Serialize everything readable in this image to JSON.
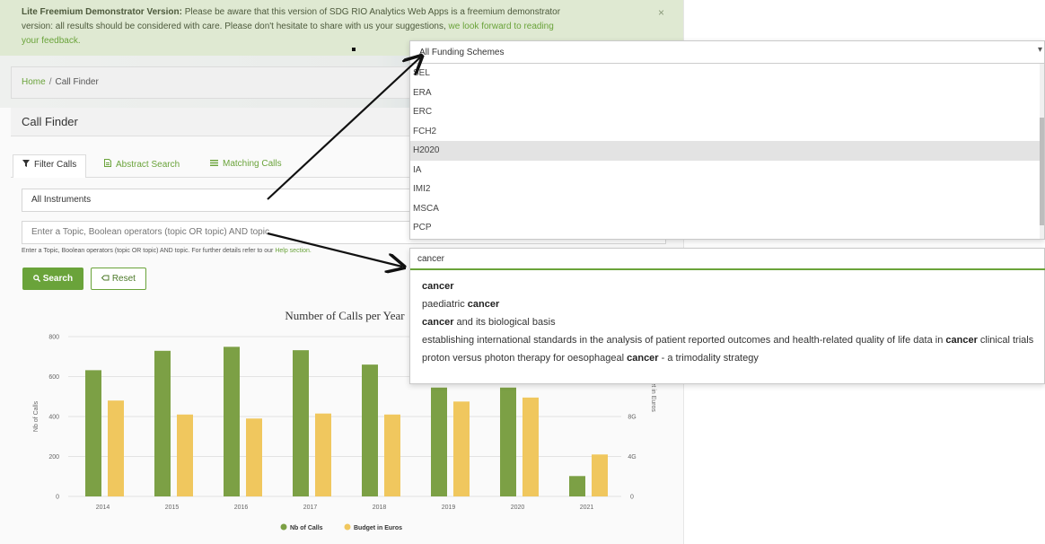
{
  "banner": {
    "bold_text": "Lite Freemium Demonstrator Version:",
    "text_line1": " Please be aware that this version of SDG RIO Analytics Web Apps is a freemium demonstrator",
    "text_line2": "version: all results should be considered with care. Please don't hesitate to share with us your suggestions, ",
    "link_text_part1": "we look forward to reading",
    "link_text_part2": "your feedback.",
    "close_label": "×"
  },
  "breadcrumb": {
    "home": "Home",
    "separator": "/",
    "current": "Call Finder"
  },
  "page_title": "Call Finder",
  "tabs": [
    {
      "label": "Filter Calls",
      "icon": "funnel-icon"
    },
    {
      "label": "Abstract Search",
      "icon": "document-icon"
    },
    {
      "label": "Matching Calls",
      "icon": "list-icon"
    }
  ],
  "filters": {
    "instrument_value": "All Instruments",
    "topic_placeholder": "Enter a Topic, Boolean operators (topic OR topic) AND topic",
    "help_text": "Enter a Topic, Boolean operators (topic OR topic) AND topic. For further details refer to our ",
    "help_link": "Help section."
  },
  "buttons": {
    "search_label": "Search",
    "reset_label": "Reset"
  },
  "funding_dropdown": {
    "selected": "All Funding Schemes",
    "options": [
      "SEL",
      "ERA",
      "ERC",
      "FCH2",
      "H2020",
      "IA",
      "IMI2",
      "MSCA",
      "PCP"
    ],
    "highlighted": "H2020"
  },
  "autocomplete": {
    "input_value": "cancer",
    "suggestions": [
      {
        "before": "",
        "match": "cancer",
        "after": ""
      },
      {
        "before": "paediatric ",
        "match": "cancer",
        "after": ""
      },
      {
        "before": "",
        "match": "cancer",
        "after": " and its biological basis"
      },
      {
        "before": "establishing international standards in the analysis of patient reported outcomes and health-related quality of life data in ",
        "match": "cancer",
        "after": " clinical trials"
      },
      {
        "before": "proton versus photon therapy for oesophageal ",
        "match": "cancer",
        "after": " - a trimodality strategy"
      }
    ]
  },
  "colors": {
    "accent": "#6aa33a",
    "bar_calls": "#7ca045",
    "bar_budget": "#f0c75e",
    "banner_bg": "#dfe9d2"
  },
  "chart_data": {
    "type": "bar",
    "title": "Number of Calls per Year",
    "categories": [
      "2014",
      "2015",
      "2016",
      "2017",
      "2018",
      "2019",
      "2020",
      "2021"
    ],
    "series": [
      {
        "name": "Nb of Calls",
        "axis": "left",
        "values": [
          632,
          729,
          749,
          732,
          660,
          545,
          545,
          102
        ]
      },
      {
        "name": "Budget in Euros",
        "axis": "right",
        "values": [
          9.6,
          8.2,
          7.8,
          8.3,
          8.2,
          9.5,
          9.9,
          4.2
        ]
      }
    ],
    "ylabel": "Nb of Calls",
    "y2label": "Budget in Euros",
    "ylim": [
      0,
      800
    ],
    "yticks": [
      "0",
      "200",
      "400",
      "600",
      "800"
    ],
    "y2lim": [
      0,
      16
    ],
    "y2ticks": [
      "0",
      "4G",
      "8G"
    ],
    "legend_position": "bottom",
    "grid": true
  }
}
